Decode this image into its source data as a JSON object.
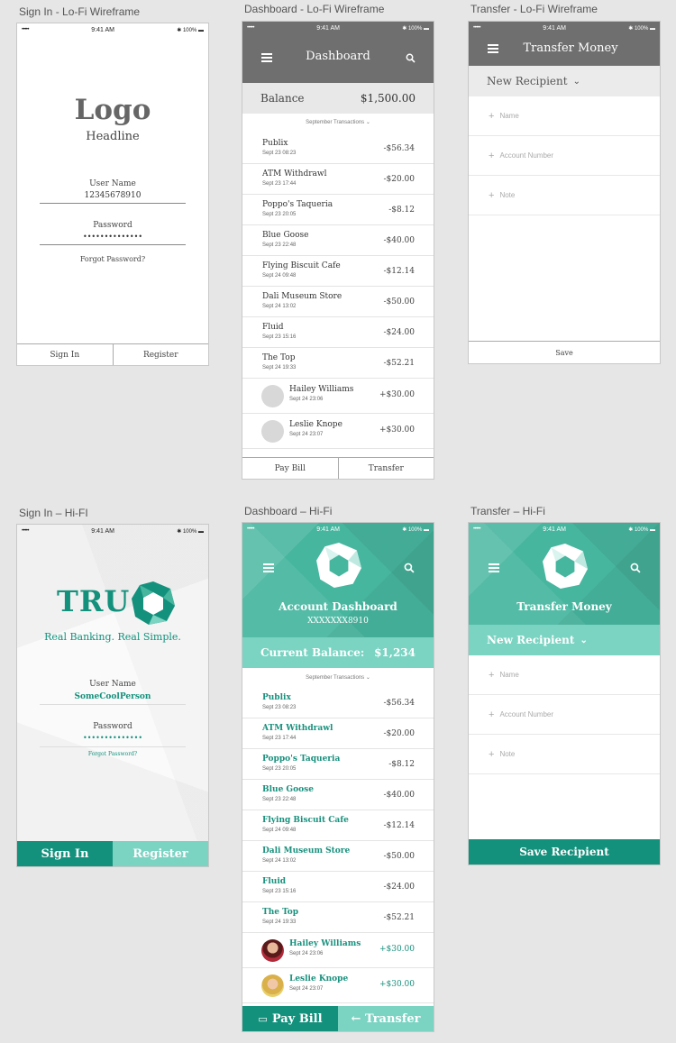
{
  "labels": {
    "signin_lofi": "Sign In - Lo-Fi Wireframe",
    "dash_lofi": "Dashboard - Lo-Fi Wireframe",
    "transfer_lofi": "Transfer - Lo-Fi Wireframe",
    "signin_hifi": "Sign In – Hi-FI",
    "dash_hifi": "Dashboard – Hi-Fi",
    "transfer_hifi": "Transfer – Hi-Fi"
  },
  "status": {
    "time": "9:41 AM",
    "battery": "100%",
    "signal": "•••••"
  },
  "signin_lofi": {
    "logo": "Logo",
    "headline": "Headline",
    "username_label": "User Name",
    "username_value": "12345678910",
    "password_label": "Password",
    "password_value": "••••••••••••••",
    "forgot": "Forgot Password?",
    "signin_btn": "Sign In",
    "register_btn": "Register"
  },
  "dash_lofi": {
    "title": "Dashboard",
    "balance_label": "Balance",
    "balance_value": "$1,500.00",
    "section": "September Transactions",
    "transactions": [
      {
        "name": "Publix",
        "date": "Sept 23  08:23",
        "amount": "-$56.34"
      },
      {
        "name": "ATM Withdrawl",
        "date": "Sept 23  17:44",
        "amount": "-$20.00"
      },
      {
        "name": "Poppo's Taqueria",
        "date": "Sept 23  20:05",
        "amount": "-$8.12"
      },
      {
        "name": "Blue Goose",
        "date": "Sept 23  22:48",
        "amount": "-$40.00"
      },
      {
        "name": "Flying Biscuit Cafe",
        "date": "Sept 24  09:48",
        "amount": "-$12.14"
      },
      {
        "name": "Dali Museum Store",
        "date": "Sept 24  13:02",
        "amount": "-$50.00"
      },
      {
        "name": "Fluid",
        "date": "Sept 23  15:16",
        "amount": "-$24.00"
      },
      {
        "name": "The Top",
        "date": "Sept 24  19:33",
        "amount": "-$52.21"
      }
    ],
    "people": [
      {
        "name": "Hailey Williams",
        "date": "Sept 24  23:06",
        "amount": "+$30.00"
      },
      {
        "name": "Leslie Knope",
        "date": "Sept 24  23:07",
        "amount": "+$30.00"
      }
    ],
    "paybill_btn": "Pay Bill",
    "transfer_btn": "Transfer"
  },
  "transfer_lofi": {
    "title": "Transfer Money",
    "new_recipient": "New Recipient",
    "fields": [
      "Name",
      "Account Number",
      "Note"
    ],
    "save_btn": "Save"
  },
  "signin_hifi": {
    "logo_text": "TRU",
    "tagline": "Real Banking. Real Simple.",
    "username_label": "User Name",
    "username_value": "SomeCoolPerson",
    "password_label": "Password",
    "password_value": "••••••••••••••",
    "forgot": "Forgot Password?",
    "signin_btn": "Sign In",
    "register_btn": "Register"
  },
  "dash_hifi": {
    "title": "Account Dashboard",
    "account": "XXXXXXX8910",
    "balance_label": "Current Balance:",
    "balance_value": "$1,234",
    "section": "September Transactions",
    "paybill_btn": "Pay Bill",
    "transfer_btn": "← Transfer"
  },
  "transfer_hifi": {
    "title": "Transfer Money",
    "new_recipient": "New Recipient",
    "fields": [
      "Name",
      "Account Number",
      "Note"
    ],
    "save_btn": "Save Recipient"
  },
  "colors": {
    "teal_dark": "#13917c",
    "teal_mid": "#47b69f",
    "teal_light": "#7bd3c2",
    "lofi_header": "#6f6f6f"
  }
}
